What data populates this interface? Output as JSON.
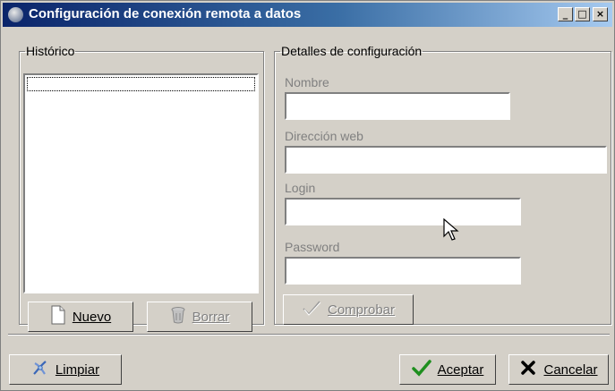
{
  "window": {
    "title": "Configuración de conexión remota a datos",
    "controls": {
      "minimize": "_",
      "maximize": "□",
      "close": "×"
    }
  },
  "history": {
    "legend": "Histórico",
    "items": [],
    "new_label": "Nuevo",
    "delete_label": "Borrar"
  },
  "details": {
    "legend": "Detalles de configuración",
    "fields": [
      {
        "label": "Nombre",
        "value": ""
      },
      {
        "label": "Dirección web",
        "value": ""
      },
      {
        "label": "Login",
        "value": ""
      },
      {
        "label": "Password",
        "value": ""
      }
    ],
    "check_label": "Comprobar"
  },
  "footer": {
    "clear_label": "Limpiar",
    "accept_label": "Aceptar",
    "cancel_label": "Cancelar"
  },
  "colors": {
    "title_start": "#0a246a",
    "title_end": "#a6caf0",
    "face": "#d4d0c8",
    "disabled_text": "#808080",
    "accept_check": "#1f8f1f",
    "cancel_x": "#000000"
  },
  "icons": {
    "app": "app-icon",
    "new": "document-icon",
    "delete": "trash-icon",
    "check": "check-icon",
    "clear": "broom-icon",
    "accept": "green-check-icon",
    "cancel": "x-icon"
  }
}
